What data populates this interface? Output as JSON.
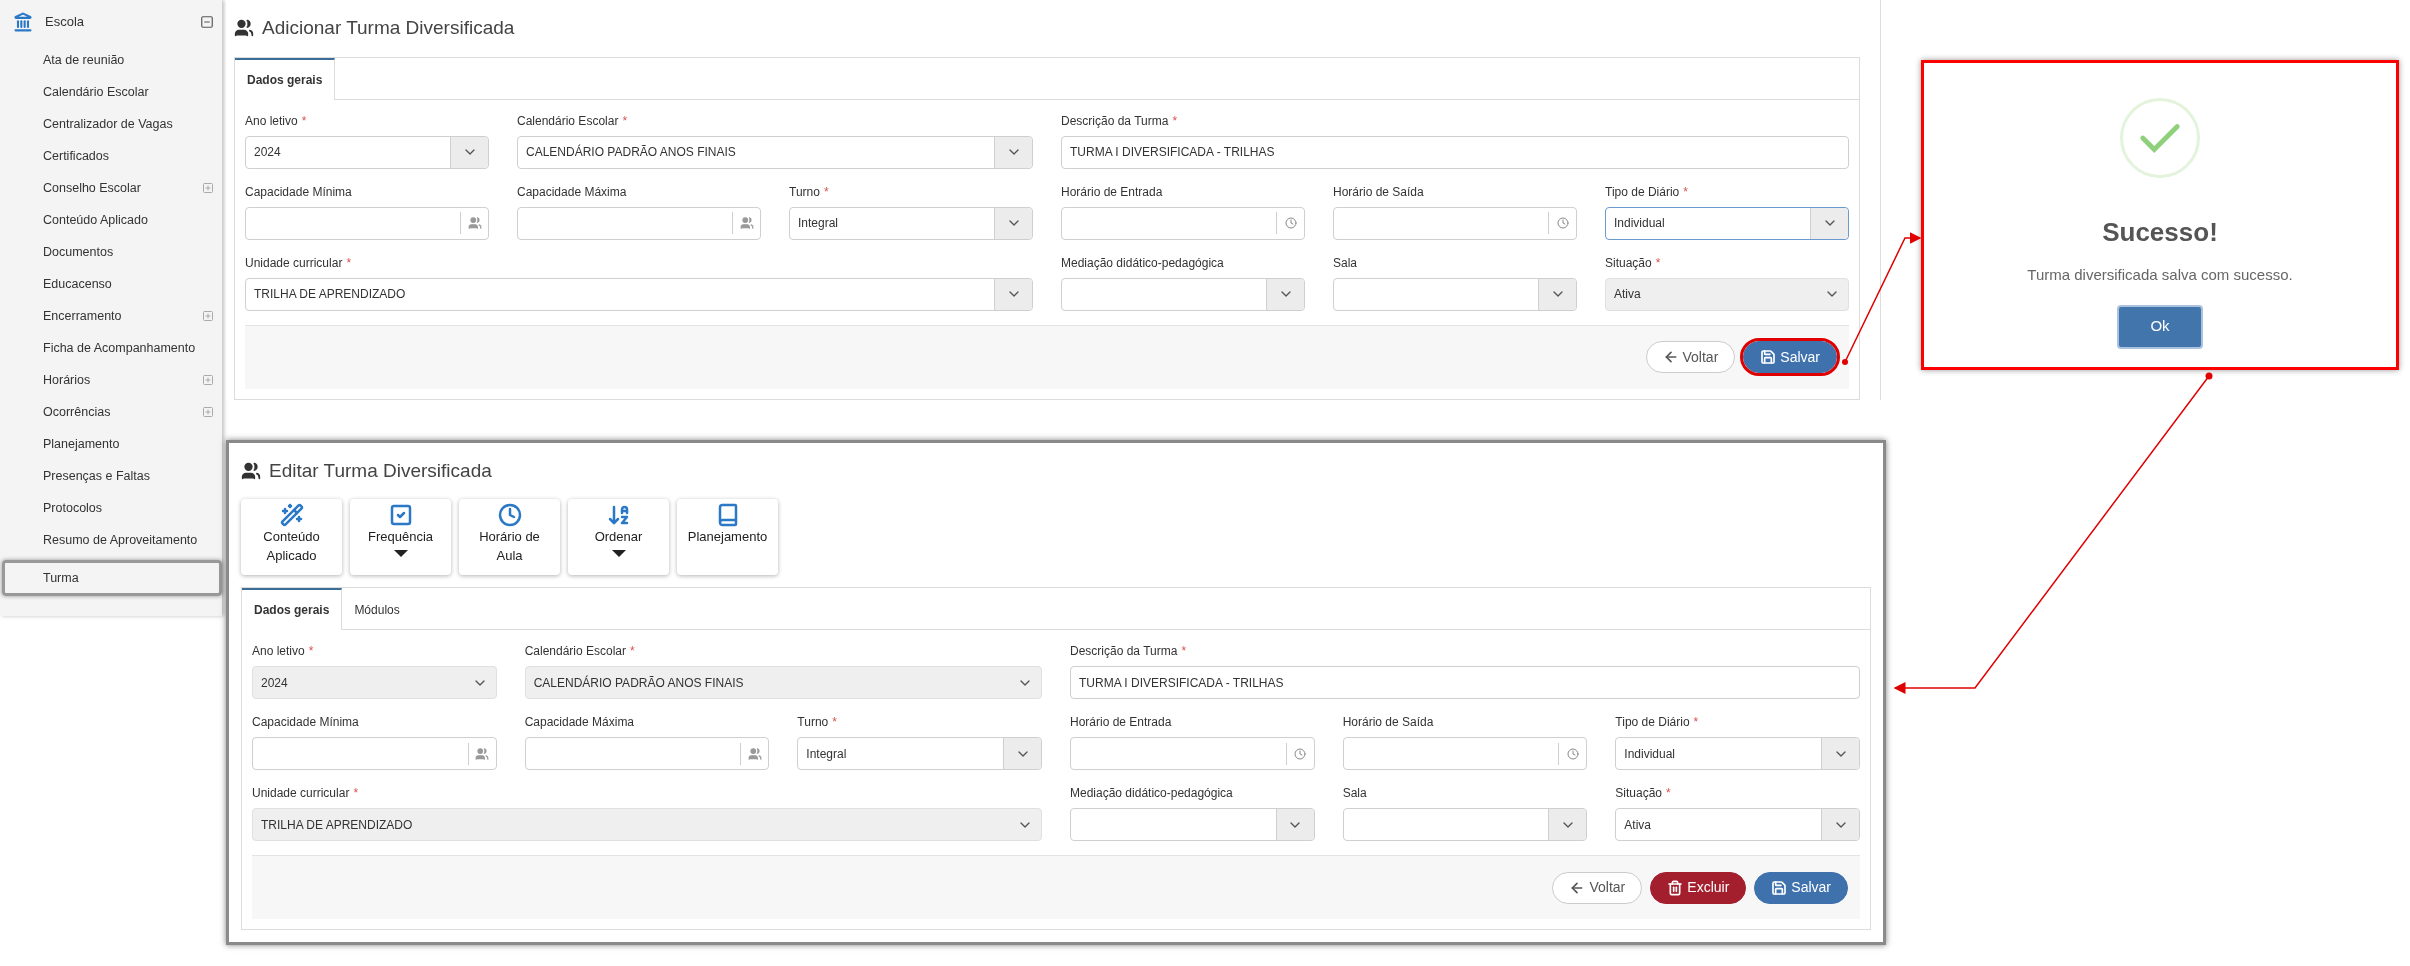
{
  "sidebar": {
    "header": {
      "label": "Escola",
      "expanded": true
    },
    "items": [
      {
        "label": "Ata de reunião",
        "expandable": false,
        "highlighted": false
      },
      {
        "label": "Calendário Escolar",
        "expandable": false,
        "highlighted": false
      },
      {
        "label": "Centralizador de Vagas",
        "expandable": false,
        "highlighted": false
      },
      {
        "label": "Certificados",
        "expandable": false,
        "highlighted": false
      },
      {
        "label": "Conselho Escolar",
        "expandable": true,
        "highlighted": false
      },
      {
        "label": "Conteúdo Aplicado",
        "expandable": false,
        "highlighted": false
      },
      {
        "label": "Documentos",
        "expandable": false,
        "highlighted": false
      },
      {
        "label": "Educacenso",
        "expandable": false,
        "highlighted": false
      },
      {
        "label": "Encerramento",
        "expandable": true,
        "highlighted": false
      },
      {
        "label": "Ficha de Acompanhamento",
        "expandable": false,
        "highlighted": false
      },
      {
        "label": "Horários",
        "expandable": true,
        "highlighted": false
      },
      {
        "label": "Ocorrências",
        "expandable": true,
        "highlighted": false
      },
      {
        "label": "Planejamento",
        "expandable": false,
        "highlighted": false
      },
      {
        "label": "Presenças e Faltas",
        "expandable": false,
        "highlighted": false
      },
      {
        "label": "Protocolos",
        "expandable": false,
        "highlighted": false
      },
      {
        "label": "Resumo de Aproveitamento",
        "expandable": false,
        "highlighted": false
      },
      {
        "label": "Turma",
        "expandable": false,
        "highlighted": true
      }
    ]
  },
  "forms": [
    {
      "title": "Adicionar Turma Diversificada",
      "highlighted": false,
      "tabs": [
        {
          "label": "Dados gerais",
          "selected": true
        }
      ],
      "fields": [
        {
          "label": "Ano letivo",
          "required_mark": "*",
          "kind": "select",
          "value": "2024",
          "disabled": false,
          "focused": false
        },
        {
          "label": "Calendário Escolar",
          "required_mark": "*",
          "kind": "select",
          "value": "CALENDÁRIO PADRÃO ANOS FINAIS",
          "disabled": false,
          "focused": false
        },
        {
          "label": "Descrição da Turma",
          "required_mark": "*",
          "kind": "text",
          "value": "TURMA I DIVERSIFICADA - TRILHAS",
          "disabled": false,
          "focused": false
        },
        {
          "label": "Capacidade Mínima",
          "kind": "people",
          "disabled": false,
          "focused": false
        },
        {
          "label": "Capacidade Máxima",
          "kind": "people",
          "disabled": false,
          "focused": false
        },
        {
          "label": "Turno",
          "required_mark": "*",
          "kind": "select",
          "value": "Integral",
          "disabled": false,
          "focused": false
        },
        {
          "label": "Horário de Entrada",
          "kind": "time",
          "disabled": false,
          "focused": false
        },
        {
          "label": "Horário de Saída",
          "kind": "time",
          "disabled": false,
          "focused": false
        },
        {
          "label": "Tipo de Diário",
          "required_mark": "*",
          "kind": "select",
          "value": "Individual",
          "disabled": false,
          "focused": true
        },
        {
          "label": "Unidade curricular",
          "required_mark": "*",
          "kind": "select",
          "value": "TRILHA DE APRENDIZADO",
          "disabled": false,
          "focused": false
        },
        {
          "label": "Mediação didático-pedagógica",
          "kind": "select",
          "disabled": false,
          "focused": false
        },
        {
          "label": "Sala",
          "kind": "select",
          "disabled": false,
          "focused": false
        },
        {
          "label": "Situação",
          "required_mark": "*",
          "kind": "select",
          "value": "Ativa",
          "disabled": true,
          "focused": false
        }
      ],
      "buttons": [
        {
          "kind": "back",
          "label": "Voltar",
          "highlighted": false
        },
        {
          "kind": "save",
          "label": "Salvar",
          "highlighted": true
        }
      ]
    },
    {
      "title": "Editar Turma Diversificada",
      "highlighted": true,
      "toolbar": [
        {
          "label": "Conteúdo Aplicado",
          "dropdown": false
        },
        {
          "label": "Frequência",
          "dropdown": true
        },
        {
          "label": "Horário de Aula",
          "dropdown": false
        },
        {
          "label": "Ordenar",
          "dropdown": true
        },
        {
          "label": "Planejamento",
          "dropdown": false
        }
      ],
      "tabs": [
        {
          "label": "Dados gerais",
          "selected": true
        },
        {
          "label": "Módulos",
          "selected": false
        }
      ],
      "fields": [
        {
          "label": "Ano letivo",
          "required_mark": "*",
          "kind": "select",
          "value": "2024",
          "disabled": true,
          "focused": false
        },
        {
          "label": "Calendário Escolar",
          "required_mark": "*",
          "kind": "select",
          "value": "CALENDÁRIO PADRÃO ANOS FINAIS",
          "disabled": true,
          "focused": false
        },
        {
          "label": "Descrição da Turma",
          "required_mark": "*",
          "kind": "text",
          "value": "TURMA I DIVERSIFICADA - TRILHAS",
          "disabled": false,
          "focused": false
        },
        {
          "label": "Capacidade Mínima",
          "kind": "people",
          "disabled": false,
          "focused": false
        },
        {
          "label": "Capacidade Máxima",
          "kind": "people",
          "disabled": false,
          "focused": false
        },
        {
          "label": "Turno",
          "required_mark": "*",
          "kind": "select",
          "value": "Integral",
          "disabled": false,
          "focused": false
        },
        {
          "label": "Horário de Entrada",
          "kind": "time",
          "disabled": false,
          "focused": false
        },
        {
          "label": "Horário de Saída",
          "kind": "time",
          "disabled": false,
          "focused": false
        },
        {
          "label": "Tipo de Diário",
          "required_mark": "*",
          "kind": "select",
          "value": "Individual",
          "disabled": false,
          "focused": false
        },
        {
          "label": "Unidade curricular",
          "required_mark": "*",
          "kind": "select",
          "value": "TRILHA DE APRENDIZADO",
          "disabled": true,
          "focused": false
        },
        {
          "label": "Mediação didático-pedagógica",
          "kind": "select",
          "disabled": false,
          "focused": false
        },
        {
          "label": "Sala",
          "kind": "select",
          "disabled": false,
          "focused": false
        },
        {
          "label": "Situação",
          "required_mark": "*",
          "kind": "select",
          "value": "Ativa",
          "disabled": false,
          "focused": false
        }
      ],
      "buttons": [
        {
          "kind": "back",
          "label": "Voltar",
          "highlighted": false
        },
        {
          "kind": "delete",
          "label": "Excluir",
          "highlighted": false
        },
        {
          "kind": "save",
          "label": "Salvar",
          "highlighted": false
        }
      ]
    }
  ],
  "dialog": {
    "title": "Sucesso!",
    "message": "Turma diversificada salva com sucesso.",
    "button": "Ok",
    "highlighted": true
  }
}
